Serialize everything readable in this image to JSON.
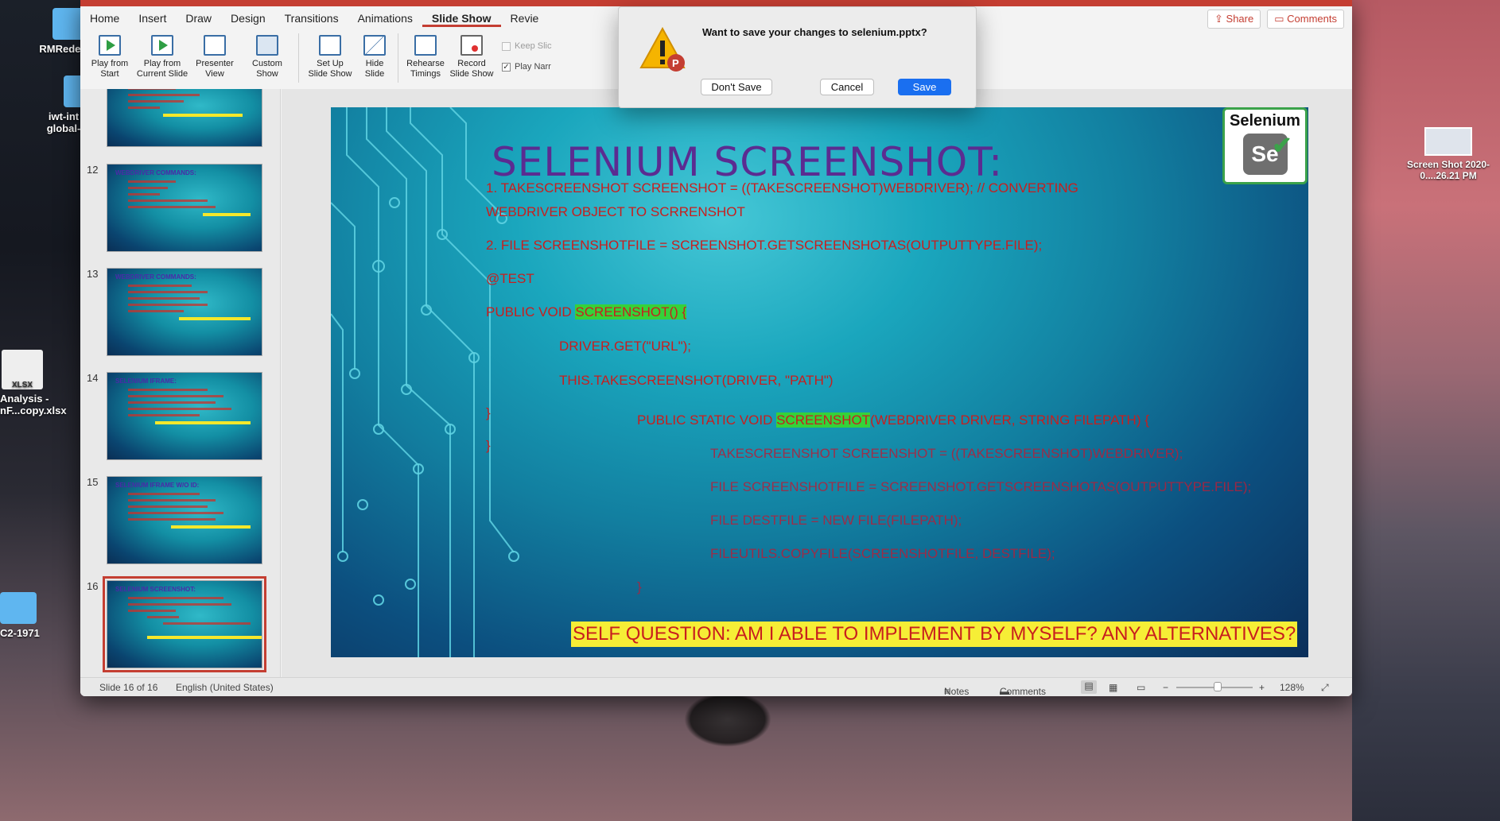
{
  "desktop": {
    "icons": [
      {
        "label": "RMRedes"
      },
      {
        "label": "iwt-int global-"
      },
      {
        "label": "Analysis - nF...copy.xlsx",
        "badge": "XLSX"
      },
      {
        "label": "C2-1971"
      },
      {
        "label": "Screen Shot 2020-0....26.21 PM"
      }
    ]
  },
  "ribbon": {
    "tabs": [
      "Home",
      "Insert",
      "Draw",
      "Design",
      "Transitions",
      "Animations",
      "Slide Show",
      "Revie"
    ],
    "active_tab": "Slide Show",
    "share_label": "Share",
    "comments_label": "Comments",
    "buttons": [
      {
        "label1": "Play from",
        "label2": "Start"
      },
      {
        "label1": "Play from",
        "label2": "Current Slide"
      },
      {
        "label1": "Presenter",
        "label2": "View"
      },
      {
        "label1": "Custom",
        "label2": "Show"
      },
      {
        "label1": "Set Up",
        "label2": "Slide Show"
      },
      {
        "label1": "Hide",
        "label2": "Slide"
      },
      {
        "label1": "Rehearse",
        "label2": "Timings"
      },
      {
        "label1": "Record",
        "label2": "Slide Show"
      }
    ],
    "keep_slide_label": "Keep Slic",
    "play_narr_label": "Play Narr"
  },
  "thumbnails": [
    {
      "num": "",
      "title": ""
    },
    {
      "num": "12",
      "title": "WEBDRIVER COMMANDS:"
    },
    {
      "num": "13",
      "title": "WEBDRIVER COMMANDS:"
    },
    {
      "num": "14",
      "title": "SELENIUM IFRAME:"
    },
    {
      "num": "15",
      "title": "SELENIUM IFRAME W/O ID:"
    },
    {
      "num": "16",
      "title": "SELENIUM SCREENSHOT:"
    }
  ],
  "slide": {
    "title": "SELENIUM SCREENSHOT:",
    "logo_text": "Selenium",
    "logo_mark": "Se",
    "lines": {
      "l1": "1. TAKESCREENSHOT SCREENSHOT = ((TAKESCREENSHOT)WEBDRIVER); // CONVERTING",
      "l1b": "WEBDRIVER OBJECT TO SCRRENSHOT",
      "l2": "2. FILE SCREENSHOTFILE = SCREENSHOT.GETSCREENSHOTAS(OUTPUTTYPE.FILE);",
      "l3": "@TEST",
      "l4a": "PUBLIC VOID ",
      "l4b": "SCREENSHOT() {",
      "l5": "DRIVER.GET(\"URL\");",
      "l6": "THIS.TAKESCREENSHOT(DRIVER, \"PATH\")",
      "l7": "}",
      "l8": "}",
      "l9a": "PUBLIC STATIC VOID ",
      "l9b": "SCREENSHOT",
      "l9c": "(WEBDRIVER DRIVER, STRING FILEPATH) {",
      "l10": "TAKESCREENSHOT SCREENSHOT = ((TAKESCREENSHOT)WEBDRIVER);",
      "l11": "FILE SCREENSHOTFILE = SCREENSHOT.GETSCREENSHOTAS(OUTPUTTYPE.FILE);",
      "l12": "FILE DESTFILE = NEW FILE(FILEPATH);",
      "l13": "FILEUTILS.COPYFILE(SCREENSHOTFILE, DESTFILE);",
      "l14": "}"
    },
    "self_question": "SELF QUESTION: AM I ABLE TO IMPLEMENT BY MYSELF? ANY ALTERNATIVES?"
  },
  "dialog": {
    "message": "Want to save your changes to selenium.pptx?",
    "dont_save": "Don't Save",
    "cancel": "Cancel",
    "save": "Save"
  },
  "status": {
    "slide_info": "Slide 16 of 16",
    "language": "English (United States)",
    "notes": "Notes",
    "comments": "Comments",
    "zoom": "128%"
  },
  "colors": {
    "accent": "#c43e32",
    "title_purple": "#5b2c91",
    "code_red": "#c81e1e",
    "highlight_green": "#35d23a",
    "highlight_yellow": "#f6ee36",
    "save_blue": "#1a6ff0"
  }
}
